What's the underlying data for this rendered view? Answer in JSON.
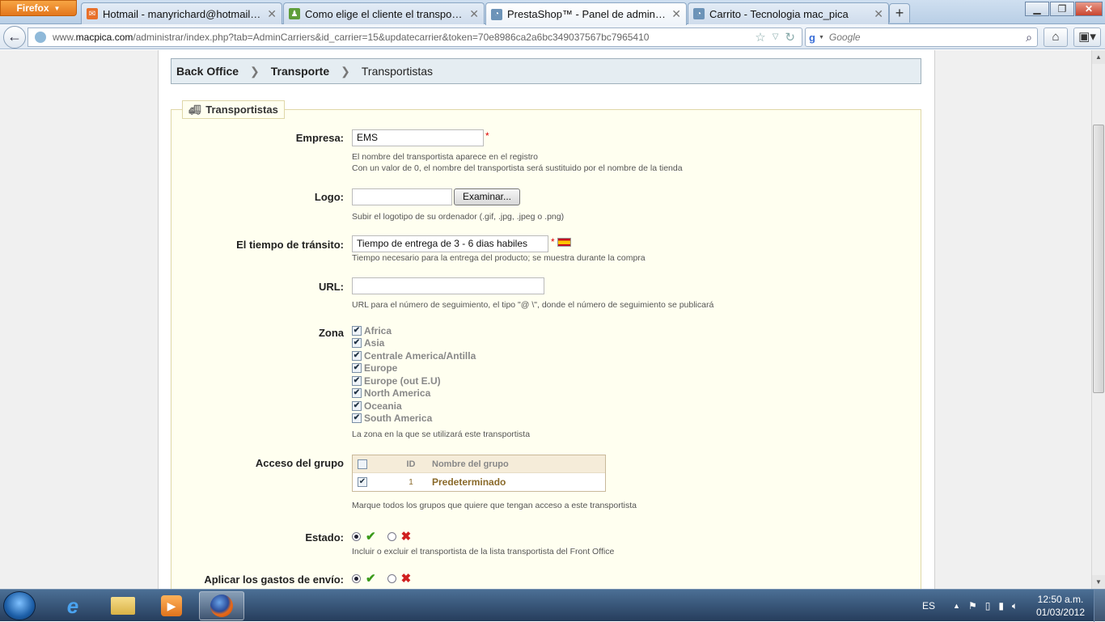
{
  "browser": {
    "app_button": "Firefox",
    "tabs": [
      {
        "title": "Hotmail - manyrichard@hotmail.com",
        "color": "#e8702a"
      },
      {
        "title": "Como elige el cliente el transporte? - ...",
        "color": "#5f9e3a"
      },
      {
        "title": "PrestaShop™ - Panel de administración",
        "color": "#6c93b8"
      },
      {
        "title": "Carrito - Tecnologia mac_pica",
        "color": "#6c93b8"
      }
    ],
    "url_prefix": "www.",
    "url_host": "macpica.com",
    "url_path": "/administrar/index.php?tab=AdminCarriers&id_carrier=15&updatecarrier&token=70e8986ca2a6bc349037567bc7965410",
    "search_placeholder": "Google"
  },
  "breadcrumb": {
    "items": [
      "Back Office",
      "Transporte",
      "Transportistas"
    ]
  },
  "form": {
    "legend": "Transportistas",
    "empresa": {
      "label": "Empresa:",
      "value": "EMS",
      "required": "*",
      "help1": "El nombre del transportista aparece en el registro",
      "help2": "Con un valor de 0, el nombre del transportista será sustituido por el nombre de la tienda"
    },
    "logo": {
      "label": "Logo:",
      "button": "Examinar...",
      "help": "Subir el logotipo de su ordenador (.gif, .jpg, .jpeg o .png)"
    },
    "transit": {
      "label": "El tiempo de tránsito:",
      "value": "Tiempo de entrega de 3 - 6 dias habiles",
      "required": "*",
      "help": "Tiempo necesario para la entrega del producto; se muestra durante la compra"
    },
    "url": {
      "label": "URL:",
      "value": "",
      "help": "URL para el número de seguimiento, el tipo \"@ \\\", donde el número de seguimiento se publicará"
    },
    "zona": {
      "label": "Zona",
      "zones": [
        "Africa",
        "Asia",
        "Centrale America/Antilla",
        "Europe",
        "Europe (out E.U)",
        "North America",
        "Oceania",
        "South America"
      ],
      "help": "La zona en la que se utilizará este transportista"
    },
    "grupo": {
      "label": "Acceso del grupo",
      "col_id": "ID",
      "col_name": "Nombre del grupo",
      "row_id": "1",
      "row_name": "Predeterminado",
      "help": "Marque todos los grupos que quiere que tengan acceso a este transportista"
    },
    "estado": {
      "label": "Estado:",
      "help": "Incluir o excluir el transportista de la lista transportista del Front Office"
    },
    "gastos": {
      "label": "Aplicar los gastos de envío:"
    }
  },
  "taskbar": {
    "language": "ES",
    "time": "12:50 a.m.",
    "date": "01/03/2012"
  }
}
